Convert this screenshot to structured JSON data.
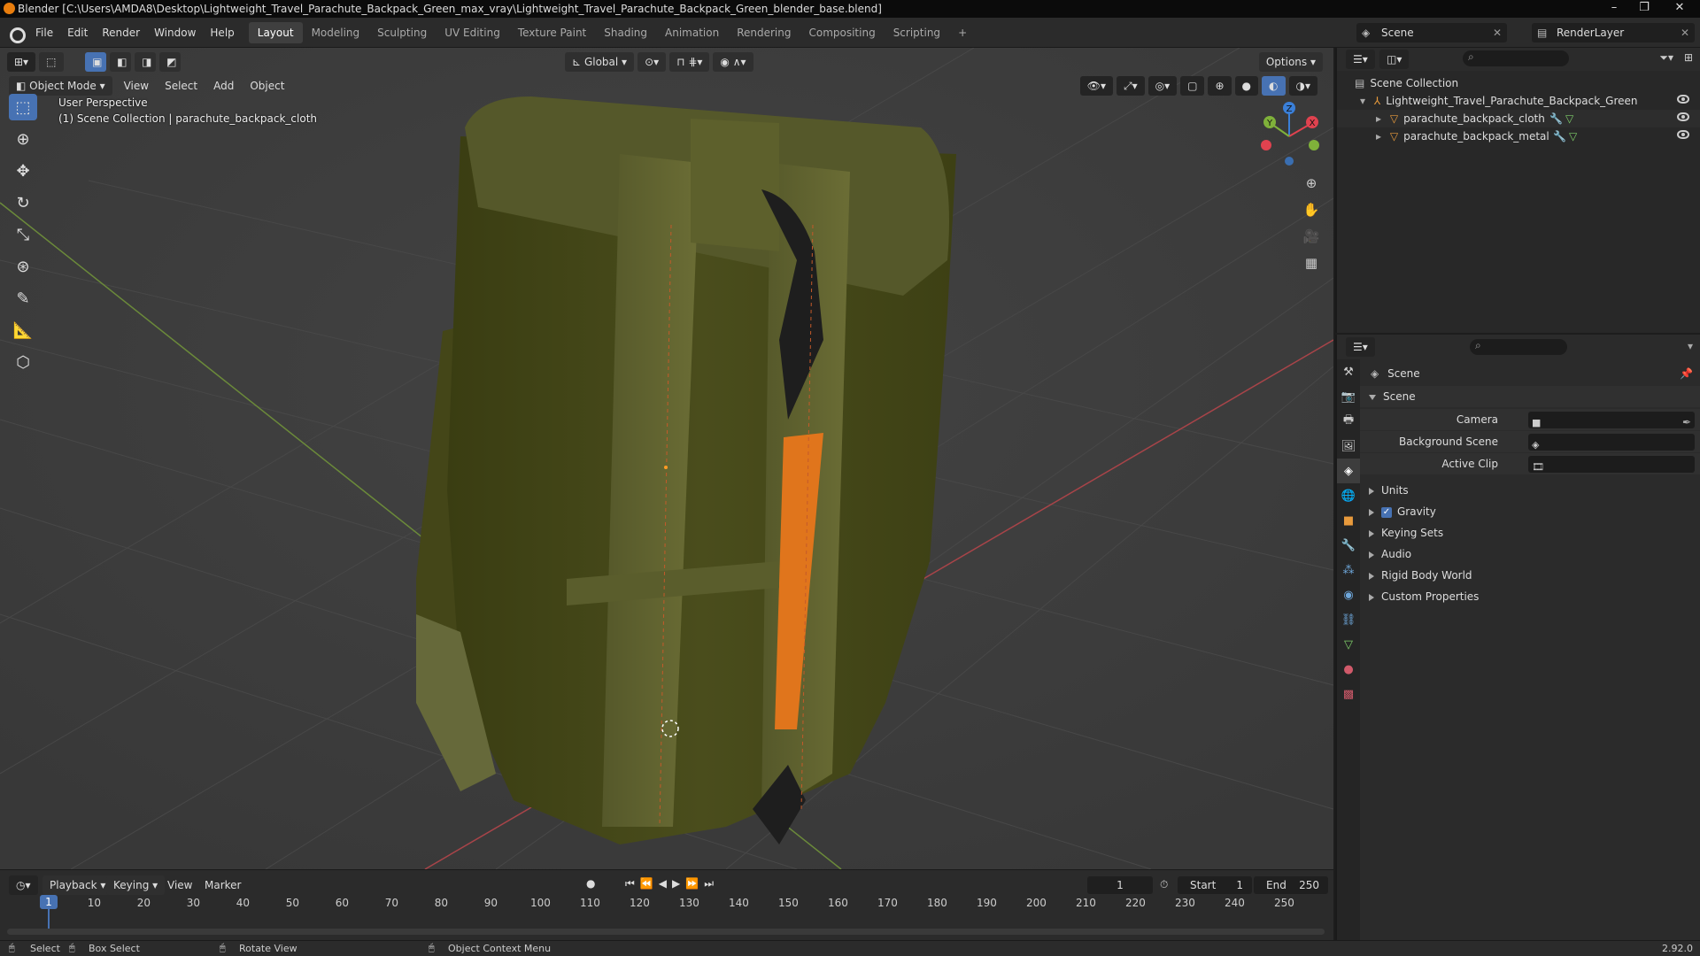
{
  "window": {
    "title": "Blender [C:\\Users\\AMDA8\\Desktop\\Lightweight_Travel_Parachute_Backpack_Green_max_vray\\Lightweight_Travel_Parachute_Backpack_Green_blender_base.blend]",
    "minimize": "–",
    "maximize": "❐",
    "close": "✕"
  },
  "menu": [
    "File",
    "Edit",
    "Render",
    "Window",
    "Help"
  ],
  "workspaces": [
    "Layout",
    "Modeling",
    "Sculpting",
    "UV Editing",
    "Texture Paint",
    "Shading",
    "Animation",
    "Rendering",
    "Compositing",
    "Scripting",
    "+"
  ],
  "active_workspace": "Layout",
  "scene_selector": "Scene",
  "view_layer": "RenderLayer",
  "viewport": {
    "transform_orientation": "Global",
    "options": "Options",
    "mode": "Object Mode",
    "menus": [
      "View",
      "Select",
      "Add",
      "Object"
    ],
    "overlay_line1": "User Perspective",
    "overlay_line2": "(1) Scene Collection | parachute_backpack_cloth",
    "gizmo_axes": [
      "X",
      "Y",
      "Z"
    ]
  },
  "outliner": {
    "root": "Scene Collection",
    "collection": "Lightweight_Travel_Parachute_Backpack_Green",
    "objects": [
      "parachute_backpack_cloth",
      "parachute_backpack_metal"
    ]
  },
  "properties": {
    "context": "Scene",
    "panel": "Scene",
    "fields": [
      {
        "label": "Camera"
      },
      {
        "label": "Background Scene"
      },
      {
        "label": "Active Clip"
      }
    ],
    "sections": [
      "Units",
      "Gravity",
      "Keying Sets",
      "Audio",
      "Rigid Body World",
      "Custom Properties"
    ],
    "gravity_enabled": true
  },
  "timeline": {
    "menus": [
      "Playback",
      "Keying",
      "View",
      "Marker"
    ],
    "current_frame": "1",
    "start_label": "Start",
    "start": "1",
    "end_label": "End",
    "end": "250",
    "ticks": [
      "1",
      "10",
      "20",
      "30",
      "40",
      "50",
      "60",
      "70",
      "80",
      "90",
      "100",
      "110",
      "120",
      "130",
      "140",
      "150",
      "160",
      "170",
      "180",
      "190",
      "200",
      "210",
      "220",
      "230",
      "240",
      "250"
    ]
  },
  "status": {
    "select": "Select",
    "box_select": "Box Select",
    "rotate_view": "Rotate View",
    "context_menu": "Object Context Menu",
    "version": "2.92.0"
  },
  "colors": {
    "accent": "#4772b3",
    "axis_x": "#e0424f",
    "axis_y": "#7fb13a",
    "axis_z": "#3a7fd8",
    "bag_green": "#4a4d1c",
    "strap_orange": "#e0751c"
  }
}
